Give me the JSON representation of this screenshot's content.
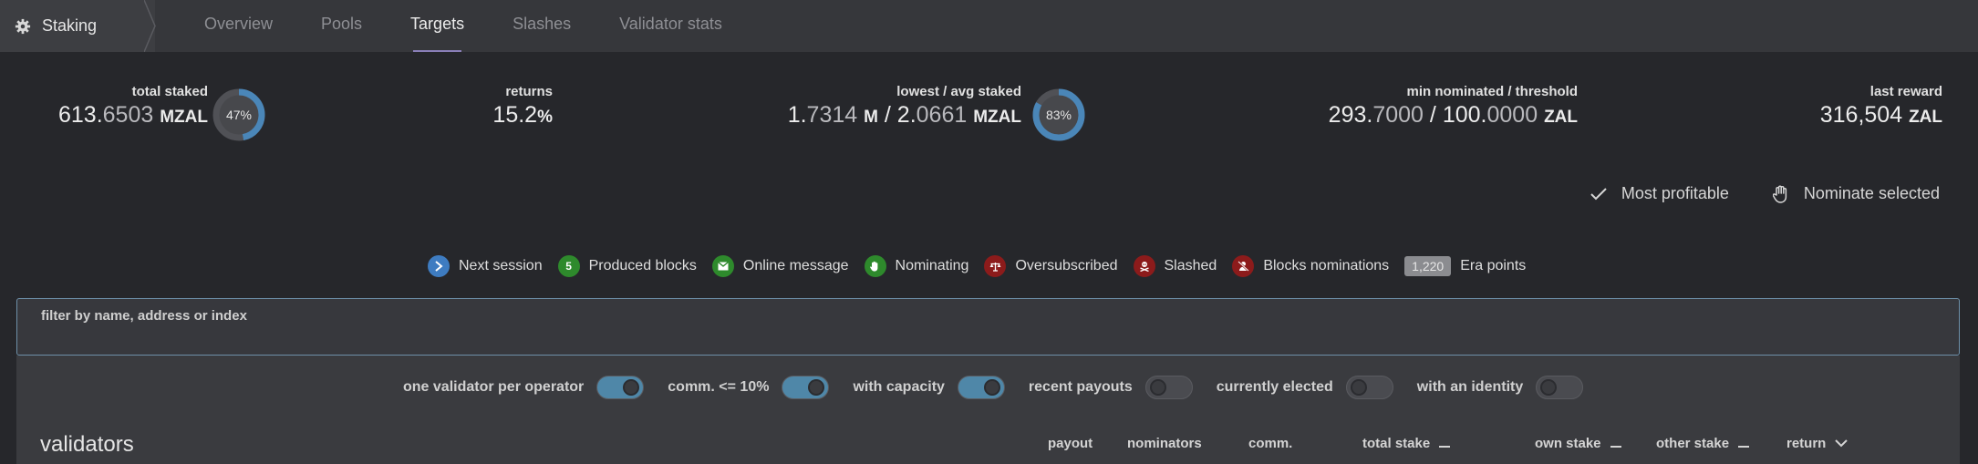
{
  "nav": {
    "brand": "Staking",
    "tabs": [
      {
        "label": "Overview",
        "active": false
      },
      {
        "label": "Pools",
        "active": false
      },
      {
        "label": "Targets",
        "active": true
      },
      {
        "label": "Slashes",
        "active": false
      },
      {
        "label": "Validator stats",
        "active": false
      }
    ]
  },
  "summary": {
    "total_staked": {
      "label": "total staked",
      "int": "613.",
      "dec": "6503",
      "unit": "MZAL",
      "percent": "47%",
      "fraction": 0.47
    },
    "returns": {
      "label": "returns",
      "value": "15.2",
      "unit": "%"
    },
    "lowest_avg": {
      "label": "lowest / avg staked",
      "low_int": "1.",
      "low_dec": "7314",
      "low_unit": "M",
      "sep": " / ",
      "avg_int": "2.",
      "avg_dec": "0661",
      "avg_unit": "MZAL",
      "percent": "83%",
      "fraction": 0.83
    },
    "min_nominated": {
      "label": "min nominated / threshold",
      "min_int": "293.",
      "min_dec": "7000",
      "sep": " / ",
      "thr_int": "100.",
      "thr_dec": "0000",
      "unit": "ZAL"
    },
    "last_reward": {
      "label": "last reward",
      "value": "316,504",
      "unit": "ZAL"
    }
  },
  "actions": {
    "most_profitable": "Most profitable",
    "nominate_selected": "Nominate selected"
  },
  "legend": {
    "next_session": "Next session",
    "produced_blocks_count": "5",
    "produced_blocks": "Produced blocks",
    "online_message": "Online message",
    "nominating": "Nominating",
    "oversubscribed": "Oversubscribed",
    "slashed": "Slashed",
    "blocks_nominations": "Blocks nominations",
    "era_points_count": "1,220",
    "era_points": "Era points"
  },
  "filter": {
    "label": "filter by name, address or index",
    "value": ""
  },
  "toggles": [
    {
      "label": "one validator per operator",
      "on": true
    },
    {
      "label": "comm. <= 10%",
      "on": true
    },
    {
      "label": "with capacity",
      "on": true
    },
    {
      "label": "recent payouts",
      "on": false
    },
    {
      "label": "currently elected",
      "on": false
    },
    {
      "label": "with an identity",
      "on": false
    }
  ],
  "table": {
    "title": "validators",
    "columns": {
      "payout": "payout",
      "nominators": "nominators",
      "comm": "comm.",
      "total_stake": "total stake",
      "own_stake": "own stake",
      "other_stake": "other stake",
      "return": "return"
    }
  },
  "colors": {
    "accent_tab": "#8a7fb8",
    "toggle_on": "#4f87a8",
    "donut_fill": "#4a86b8"
  }
}
